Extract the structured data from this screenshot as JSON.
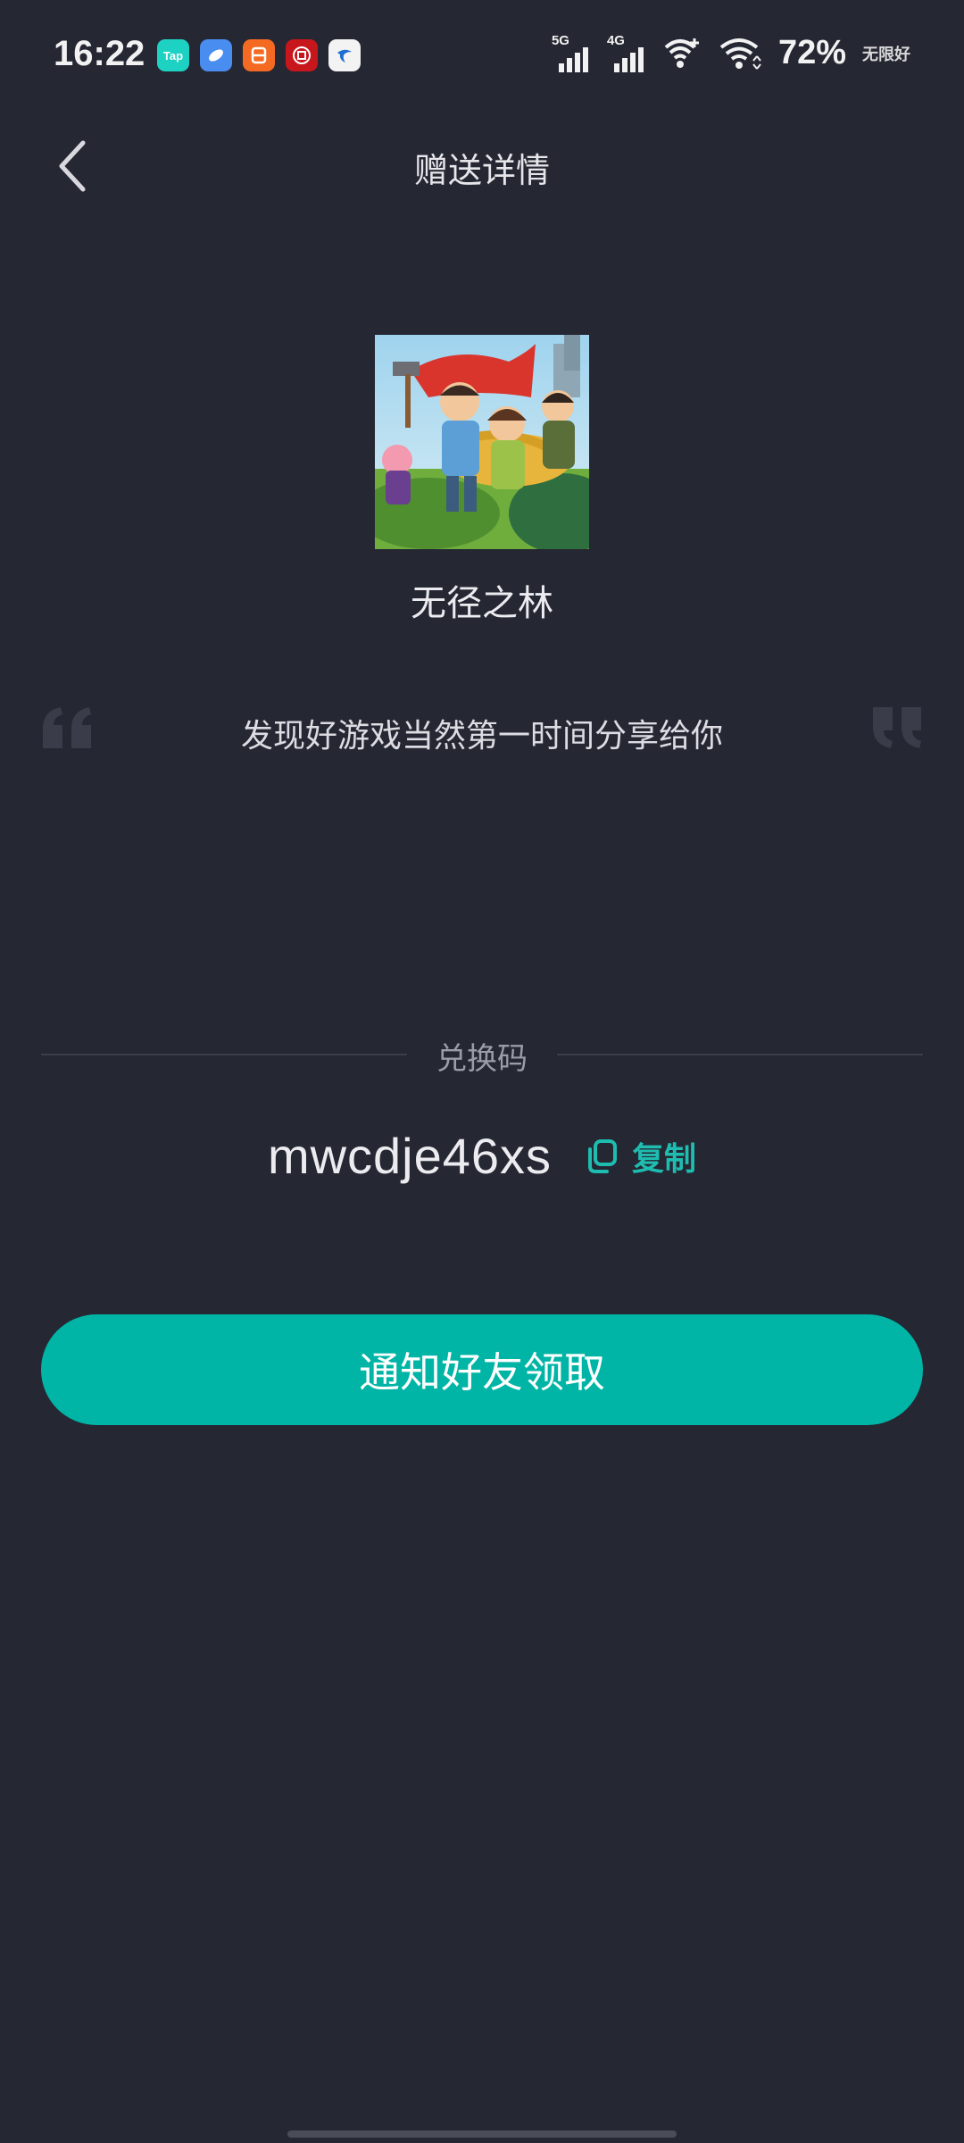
{
  "status_bar": {
    "time": "16:22",
    "app_icons": [
      {
        "name": "taptap-icon",
        "label": "Tap",
        "color": "#1ed2c3"
      },
      {
        "name": "browser-icon",
        "label": "",
        "color": "#4a8df0"
      },
      {
        "name": "taobao-special-icon",
        "label": "",
        "color": "#f46a22"
      },
      {
        "name": "bank-icon",
        "label": "",
        "color": "#c8161d"
      },
      {
        "name": "china-telecom-icon",
        "label": "",
        "color": "#f3f3f3"
      }
    ],
    "signal_1_tag": "5G",
    "signal_2_tag": "4G",
    "battery": "72%",
    "carrier": "无限好"
  },
  "header": {
    "title": "赠送详情"
  },
  "game": {
    "name": "无径之林"
  },
  "share": {
    "message": "发现好游戏当然第一时间分享给你"
  },
  "redeem": {
    "label": "兑换码",
    "code": "mwcdje46xs",
    "copy_label": "复制"
  },
  "actions": {
    "notify_label": "通知好友领取"
  },
  "colors": {
    "background": "#252733",
    "accent": "#00b5a6",
    "accent_text": "#1fbcb0"
  }
}
